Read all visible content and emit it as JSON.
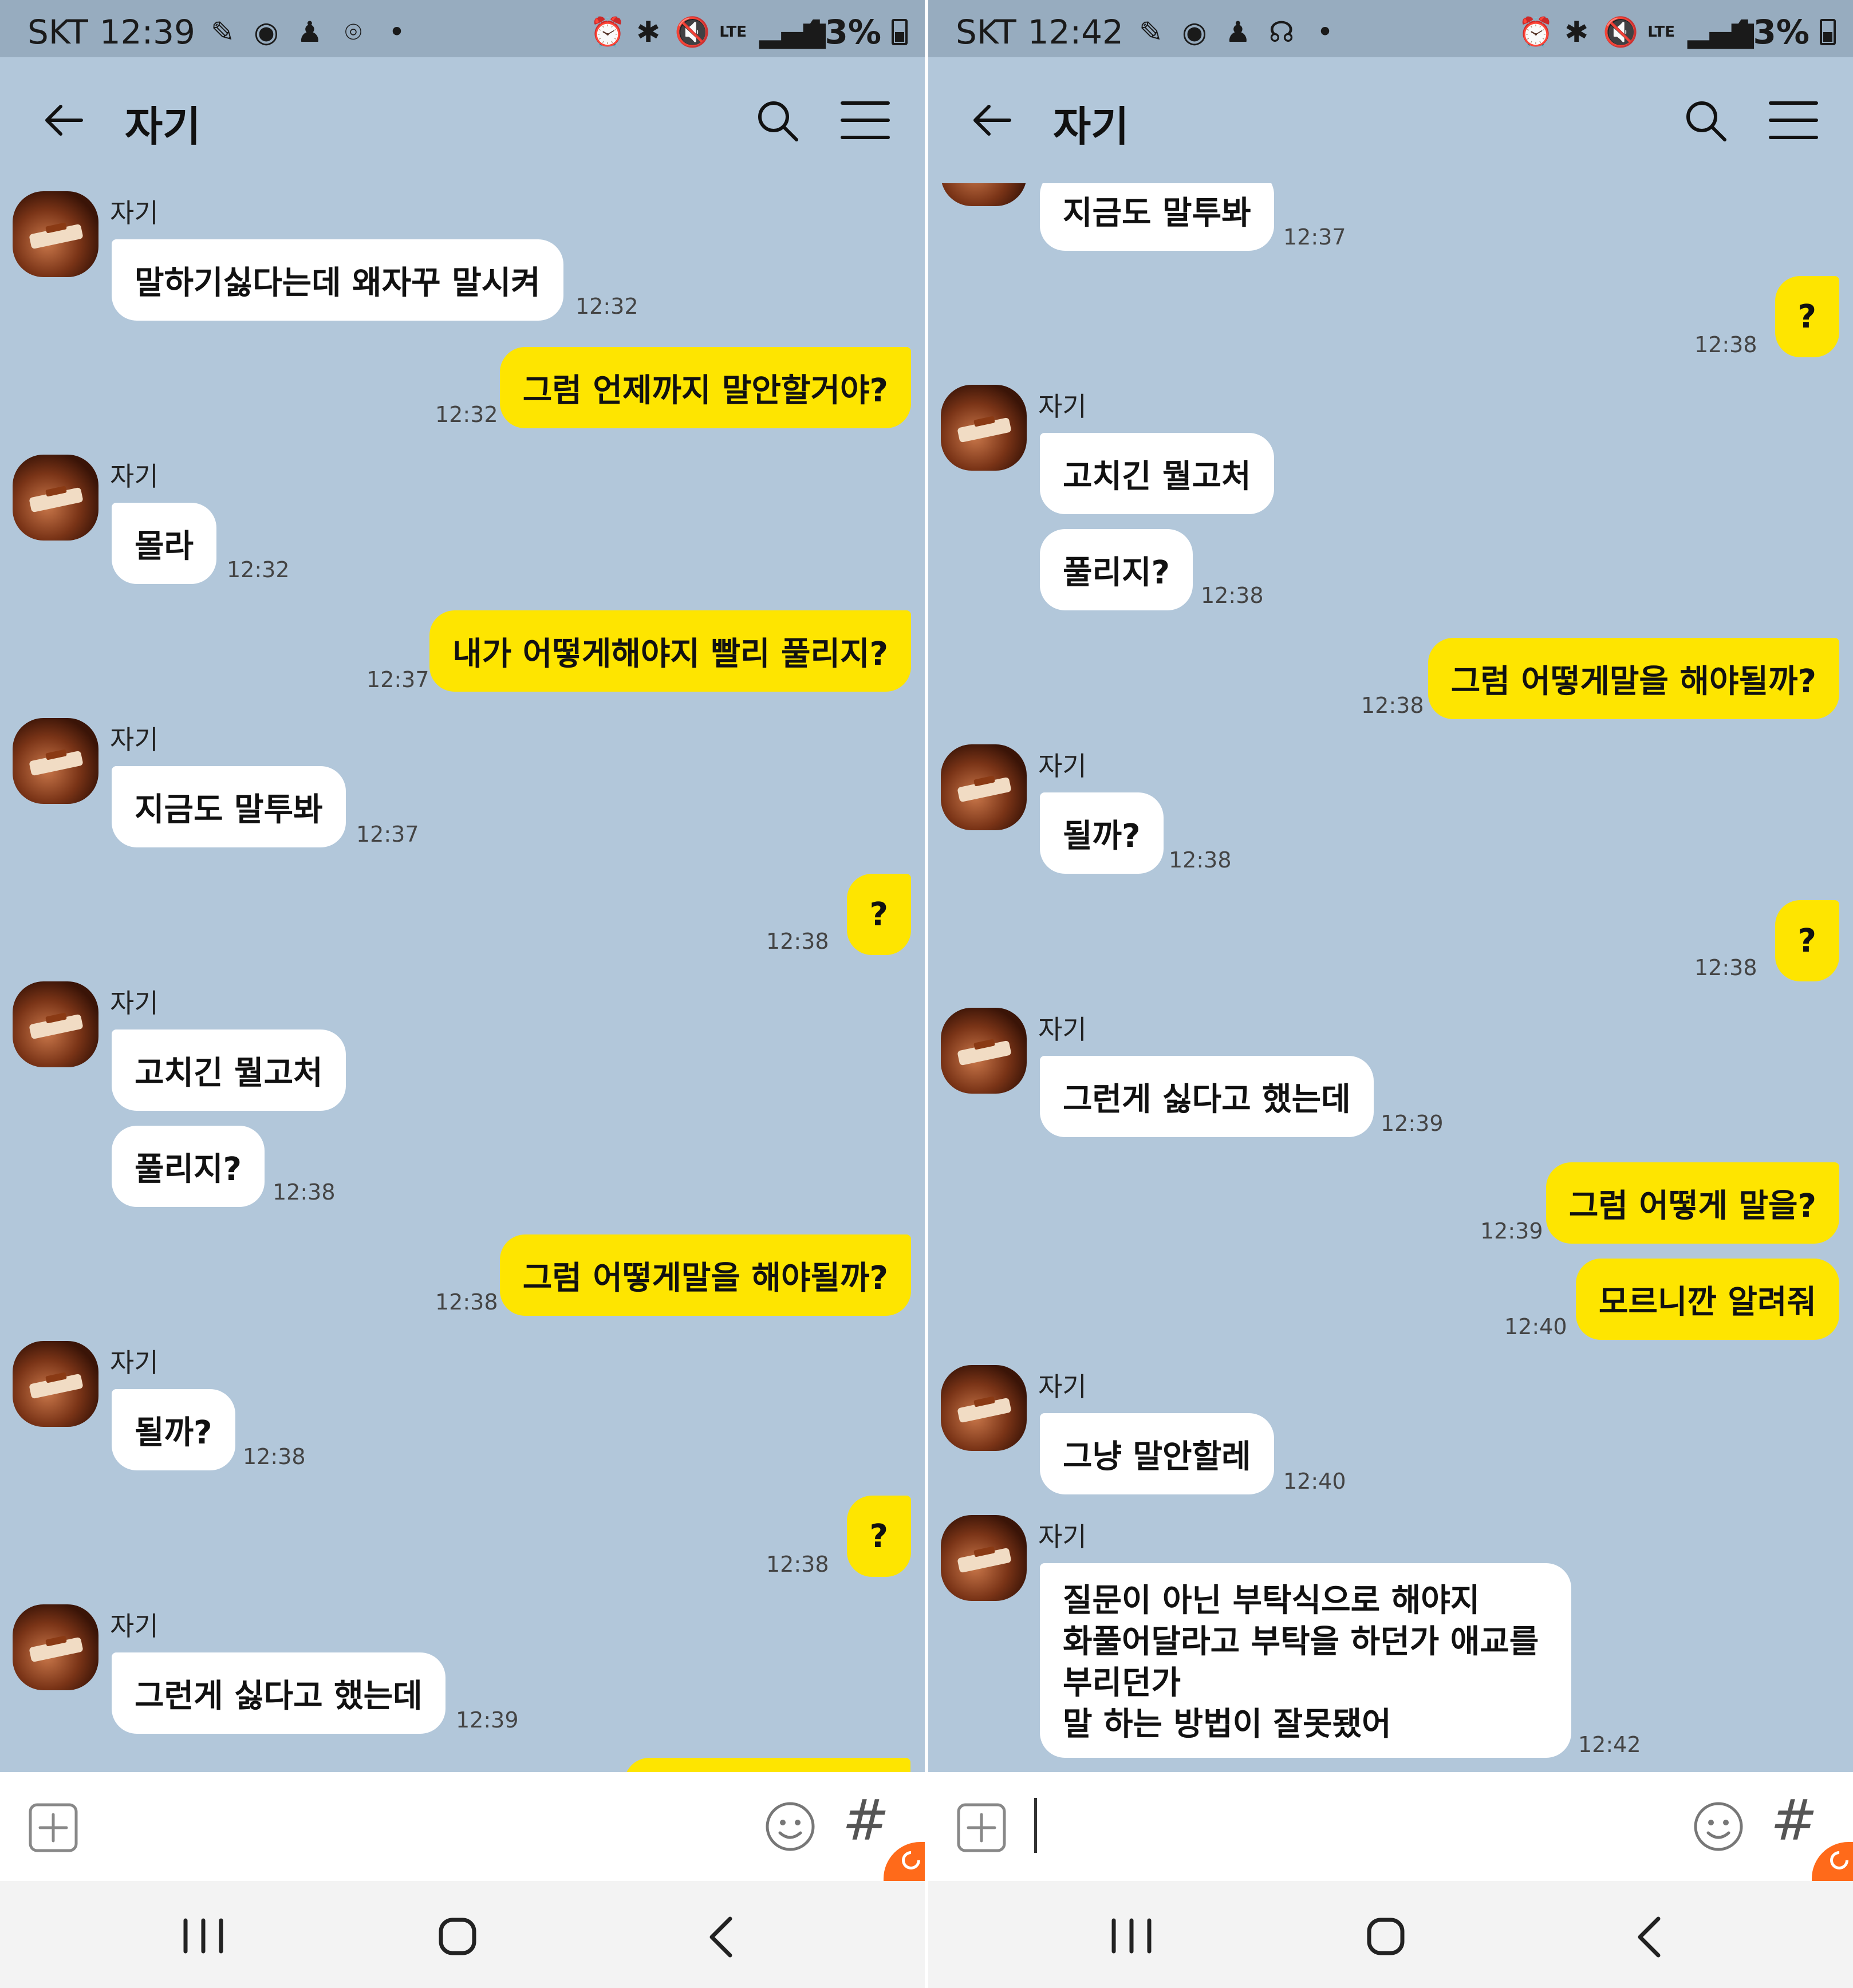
{
  "left": {
    "status": {
      "carrier": "SKT",
      "time": "12:39",
      "battery": "43%"
    },
    "header": {
      "title": "자기"
    },
    "messages": [
      {
        "sender": "자기",
        "text": "말하기싫다는데 왜자꾸 말시켜",
        "time": "12:32"
      },
      {
        "text": "그럼 언제까지 말안할거야?",
        "time": "12:32"
      },
      {
        "sender": "자기",
        "text": "몰라",
        "time": "12:32"
      },
      {
        "text": "내가 어떻게해야지 빨리 풀리지?",
        "time": "12:37"
      },
      {
        "sender": "자기",
        "text": "지금도 말투봐",
        "time": "12:37"
      },
      {
        "text": "?",
        "time": "12:38"
      },
      {
        "sender": "자기",
        "text": "고치긴 뭘고처"
      },
      {
        "text": "풀리지?",
        "time": "12:38"
      },
      {
        "text": "그럼 어떻게말을 해야될까?",
        "time": "12:38"
      },
      {
        "sender": "자기",
        "text": "될까?",
        "time": "12:38"
      },
      {
        "text": "?",
        "time": "12:38"
      },
      {
        "sender": "자기",
        "text": "그런게 싫다고 했는데",
        "time": "12:39"
      }
    ]
  },
  "right": {
    "status": {
      "carrier": "SKT",
      "time": "12:42",
      "battery": "43%"
    },
    "header": {
      "title": "자기"
    },
    "messages": [
      {
        "text": "지금도 말투봐",
        "time": "12:37"
      },
      {
        "text": "?",
        "time": "12:38"
      },
      {
        "sender": "자기",
        "text": "고치긴 뭘고처"
      },
      {
        "text": "풀리지?",
        "time": "12:38"
      },
      {
        "text": "그럼 어떻게말을 해야될까?",
        "time": "12:38"
      },
      {
        "sender": "자기",
        "text": "될까?",
        "time": "12:38"
      },
      {
        "text": "?",
        "time": "12:38"
      },
      {
        "sender": "자기",
        "text": "그런게 싫다고 했는데",
        "time": "12:39"
      },
      {
        "text": "그럼 어떻게 말을?",
        "time": "12:39"
      },
      {
        "text": "모르니깐 알려줘",
        "time": "12:40"
      },
      {
        "sender": "자기",
        "text": "그냥 말안할레",
        "time": "12:40"
      },
      {
        "sender": "자기",
        "lines": [
          "질문이 아닌 부탁식으로 해야지",
          "화풀어달라고 부탁을 하던가 애교를",
          "부리던가",
          "말 하는 방법이 잘못됐어"
        ],
        "time": "12:42"
      }
    ]
  },
  "input": {
    "hash_label": "#"
  },
  "colors": {
    "background": "#b2c7da",
    "sent_bubble": "#fee500",
    "received_bubble": "#ffffff",
    "status_bar": "#97acbf"
  },
  "icons": {
    "status": [
      "pen-icon",
      "rec-icon",
      "figure-icon",
      "location-icon",
      "headset-icon",
      "alarm-icon",
      "bluetooth-icon",
      "mute-icon",
      "lte-icon",
      "signal-icon",
      "battery-icon"
    ],
    "header": [
      "back-arrow-icon",
      "search-icon",
      "menu-icon"
    ],
    "input": [
      "plus-icon",
      "emoji-icon",
      "hashtag-icon"
    ],
    "nav": [
      "recent-apps-icon",
      "home-icon",
      "back-icon"
    ]
  }
}
